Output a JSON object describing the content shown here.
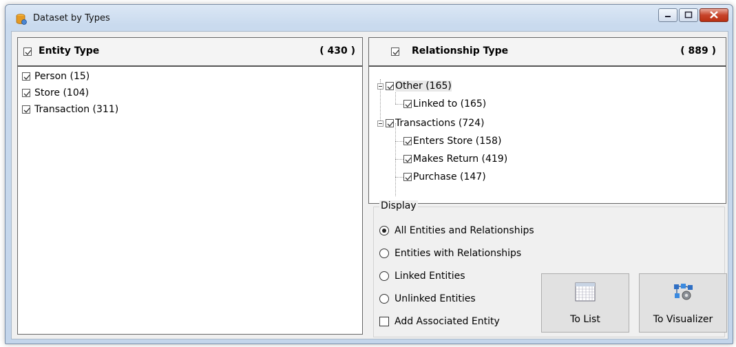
{
  "window": {
    "title": "Dataset by Types",
    "buttons": [
      "minimize",
      "maximize",
      "close"
    ]
  },
  "entity_panel": {
    "header_label": "Entity Type",
    "header_checked": true,
    "count": "( 430 )",
    "items": [
      {
        "label": "Person (15)",
        "checked": true
      },
      {
        "label": "Store (104)",
        "checked": true
      },
      {
        "label": "Transaction (311)",
        "checked": true
      }
    ]
  },
  "relationship_panel": {
    "header_label": "Relationship Type",
    "header_checked": true,
    "count": "( 889 )",
    "tree": [
      {
        "label": "Other (165)",
        "checked": true,
        "expanded": true,
        "children": [
          {
            "label": "Linked to (165)",
            "checked": true
          }
        ]
      },
      {
        "label": "Transactions (724)",
        "checked": true,
        "expanded": true,
        "children": [
          {
            "label": "Enters Store (158)",
            "checked": true
          },
          {
            "label": "Makes Return (419)",
            "checked": true
          },
          {
            "label": "Purchase (147)",
            "checked": true
          }
        ]
      }
    ]
  },
  "display": {
    "legend": "Display",
    "options": [
      {
        "label": "All Entities and Relationships",
        "selected": true
      },
      {
        "label": "Entities with Relationships",
        "selected": false
      },
      {
        "label": "Linked Entities",
        "selected": false
      },
      {
        "label": "Unlinked Entities",
        "selected": false
      }
    ],
    "add_associated": {
      "label": "Add Associated Entity",
      "checked": false
    },
    "to_list_label": "To List",
    "to_visualizer_label": "To Visualizer"
  }
}
